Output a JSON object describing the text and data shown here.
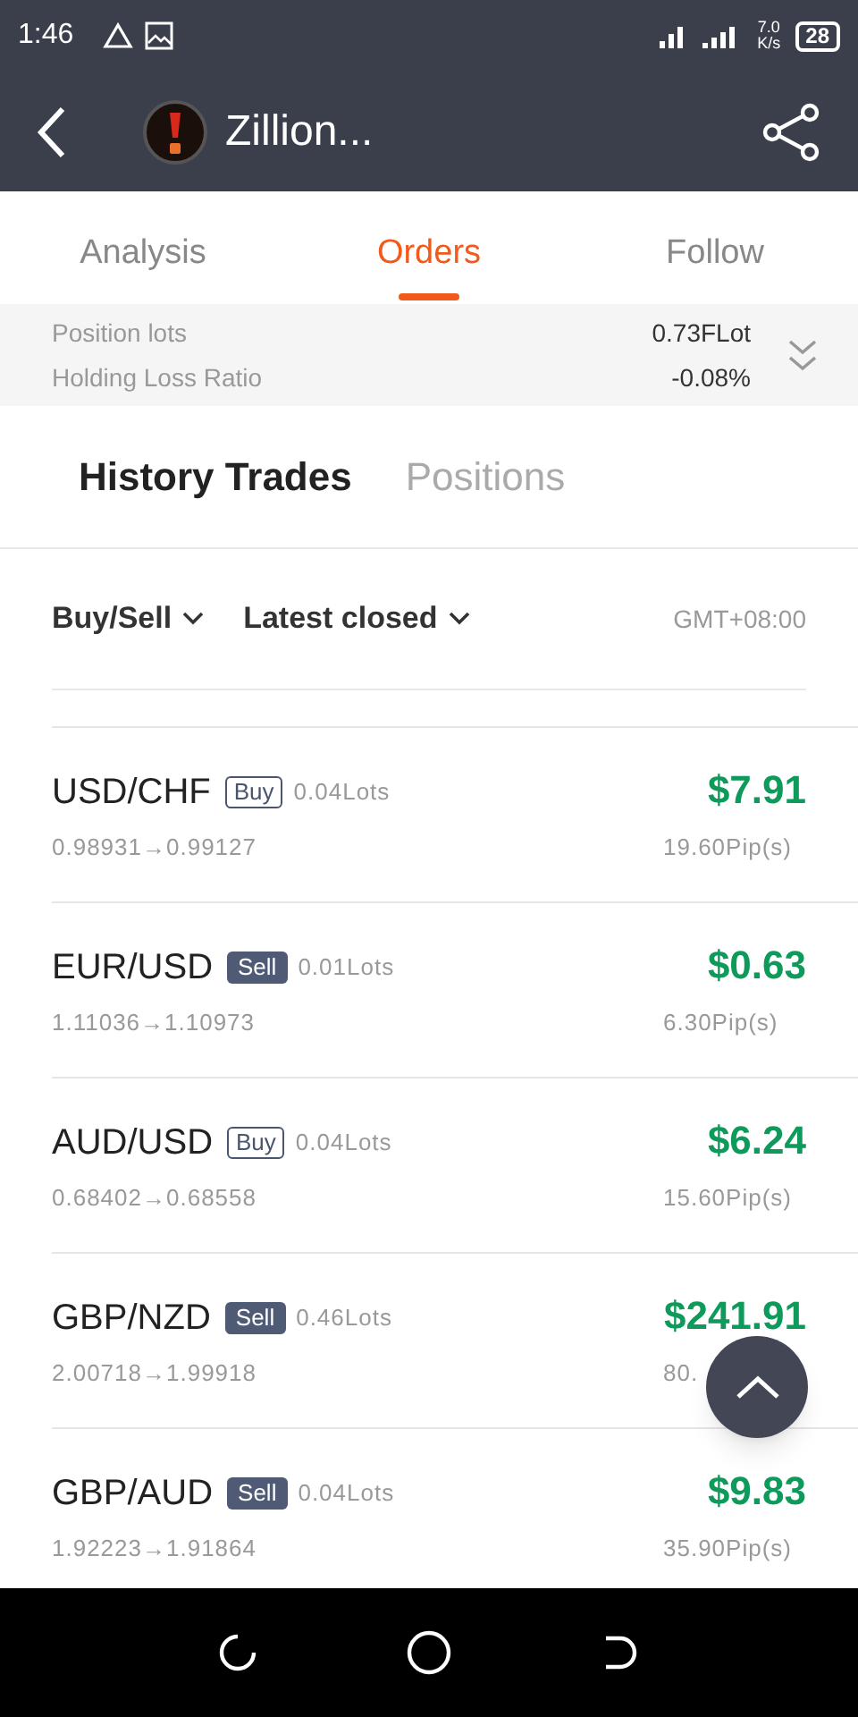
{
  "status_bar": {
    "time": "1:46",
    "network_speed": "7.0",
    "network_unit": "K/s",
    "battery": "28"
  },
  "header": {
    "title": "Zillion..."
  },
  "tabs": [
    {
      "label": "Analysis",
      "selected": false
    },
    {
      "label": "Orders",
      "selected": true
    },
    {
      "label": "Follow",
      "selected": false
    }
  ],
  "summary": [
    {
      "label": "Position lots",
      "value": "0.73FLot"
    },
    {
      "label": "Holding Loss Ratio",
      "value": "-0.08%"
    }
  ],
  "subtabs": [
    {
      "label": "History Trades",
      "selected": true
    },
    {
      "label": "Positions",
      "selected": false
    }
  ],
  "filters": {
    "side": "Buy/Sell",
    "sort": "Latest closed",
    "timezone": "GMT+08:00"
  },
  "trades": [
    {
      "pair": "USD/CHF",
      "side": "Buy",
      "kind": "buy",
      "lots": "0.04Lots",
      "prices": "0.98931→0.99127",
      "profit": "$7.91",
      "pips": "19.60Pip(s)"
    },
    {
      "pair": "EUR/USD",
      "side": "Sell",
      "kind": "sell",
      "lots": "0.01Lots",
      "prices": "1.11036→1.10973",
      "profit": "$0.63",
      "pips": "6.30Pip(s)"
    },
    {
      "pair": "AUD/USD",
      "side": "Buy",
      "kind": "buy",
      "lots": "0.04Lots",
      "prices": "0.68402→0.68558",
      "profit": "$6.24",
      "pips": "15.60Pip(s)"
    },
    {
      "pair": "GBP/NZD",
      "side": "Sell",
      "kind": "sell",
      "lots": "0.46Lots",
      "prices": "2.00718→1.99918",
      "profit": "$241.91",
      "pips": "80."
    },
    {
      "pair": "GBP/AUD",
      "side": "Sell",
      "kind": "sell",
      "lots": "0.04Lots",
      "prices": "1.92223→1.91864",
      "profit": "$9.83",
      "pips": "35.90Pip(s)"
    }
  ]
}
